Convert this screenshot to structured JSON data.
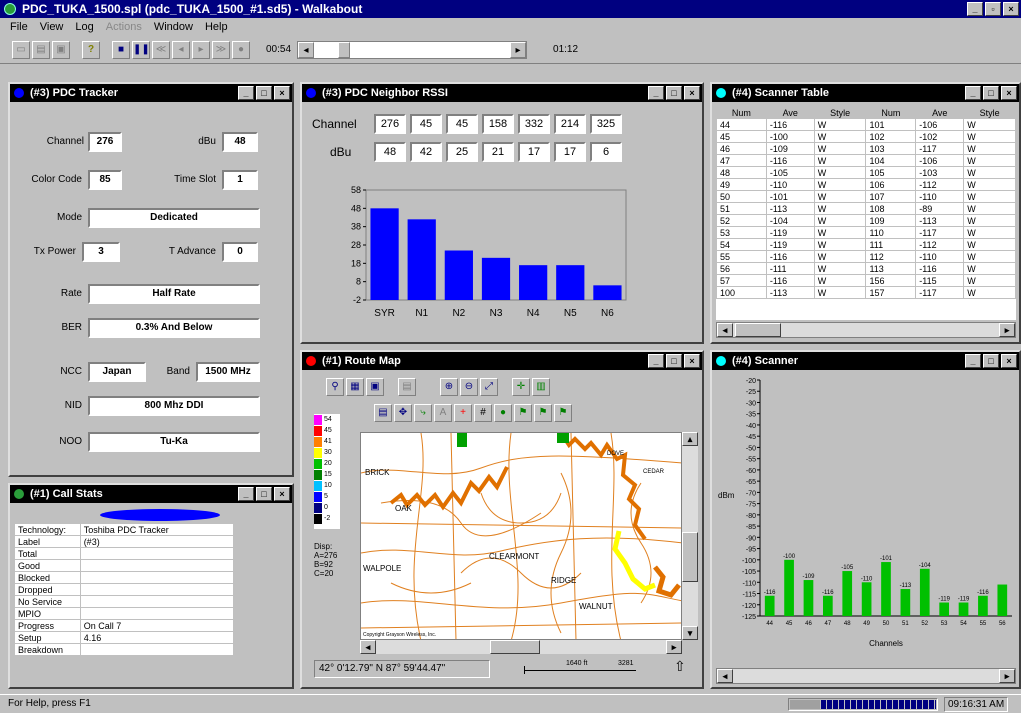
{
  "app": {
    "title": "PDC_TUKA_1500.spl (pdc_TUKA_1500_#1.sd5) - Walkabout"
  },
  "menu": [
    "File",
    "View",
    "Log",
    "Actions",
    "Window",
    "Help"
  ],
  "toolbar": {
    "time_start": "00:54",
    "time_end": "01:12"
  },
  "tracker": {
    "title": "(#3) PDC Tracker",
    "channel_label": "Channel",
    "channel": "276",
    "dbu_label": "dBu",
    "dbu": "48",
    "color_code_label": "Color Code",
    "color_code": "85",
    "time_slot_label": "Time Slot",
    "time_slot": "1",
    "mode_label": "Mode",
    "mode": "Dedicated",
    "tx_power_label": "Tx Power",
    "tx_power": "3",
    "t_advance_label": "T Advance",
    "t_advance": "0",
    "rate_label": "Rate",
    "rate": "Half Rate",
    "ber_label": "BER",
    "ber": "0.3% And Below",
    "ncc_label": "NCC",
    "ncc": "Japan",
    "band_label": "Band",
    "band": "1500 MHz",
    "nid_label": "NID",
    "nid": "800 Mhz DDI",
    "noo_label": "NOO",
    "noo": "Tu-Ka"
  },
  "rssi": {
    "title": "(#3) PDC Neighbor RSSI",
    "channel_label": "Channel",
    "dbu_label": "dBu",
    "channels": [
      "276",
      "45",
      "45",
      "158",
      "332",
      "214",
      "325"
    ],
    "dbus": [
      "48",
      "42",
      "25",
      "21",
      "17",
      "17",
      "6"
    ]
  },
  "chart_data": [
    {
      "type": "bar",
      "categories": [
        "SYR",
        "N1",
        "N2",
        "N3",
        "N4",
        "N5",
        "N6"
      ],
      "values": [
        48,
        42,
        25,
        21,
        17,
        17,
        6
      ],
      "ylim": [
        -2,
        58
      ],
      "yticks": [
        "58",
        "48",
        "38",
        "28",
        "18",
        "8",
        "-2"
      ],
      "color": "#0000ff"
    },
    {
      "type": "bar",
      "title": "",
      "ylabel": "dBm",
      "xlabel": "Channels",
      "categories": [
        "44",
        "45",
        "46",
        "47",
        "48",
        "49",
        "50",
        "51",
        "52",
        "53",
        "54",
        "55",
        "56"
      ],
      "values": [
        -116,
        -100,
        -109,
        -116,
        -105,
        -110,
        -101,
        -113,
        -104,
        -119,
        -119,
        -116,
        -111
      ],
      "value_labels": [
        "-116",
        "-100",
        "-109",
        "-116",
        "-105",
        "-110",
        "-101",
        "-113",
        "-104",
        "-119",
        "-119",
        "-116",
        ""
      ],
      "ylim": [
        -125,
        -20
      ],
      "yticks": [
        "-20",
        "-25",
        "-30",
        "-35",
        "-40",
        "-45",
        "-50",
        "-55",
        "-60",
        "-65",
        "-70",
        "-75",
        "-80",
        "-85",
        "-90",
        "-95",
        "-100",
        "-105",
        "-110",
        "-115",
        "-120",
        "-125"
      ],
      "color": "#00c000"
    }
  ],
  "scanner_table": {
    "title": "(#4) Scanner Table",
    "headers": [
      "Num",
      "Ave",
      "Style",
      "Num",
      "Ave",
      "Style"
    ],
    "rows": [
      [
        "44",
        "-116",
        "W",
        "101",
        "-106",
        "W"
      ],
      [
        "45",
        "-100",
        "W",
        "102",
        "-102",
        "W"
      ],
      [
        "46",
        "-109",
        "W",
        "103",
        "-117",
        "W"
      ],
      [
        "47",
        "-116",
        "W",
        "104",
        "-106",
        "W"
      ],
      [
        "48",
        "-105",
        "W",
        "105",
        "-103",
        "W"
      ],
      [
        "49",
        "-110",
        "W",
        "106",
        "-112",
        "W"
      ],
      [
        "50",
        "-101",
        "W",
        "107",
        "-110",
        "W"
      ],
      [
        "51",
        "-113",
        "W",
        "108",
        "-89",
        "W"
      ],
      [
        "52",
        "-104",
        "W",
        "109",
        "-113",
        "W"
      ],
      [
        "53",
        "-119",
        "W",
        "110",
        "-117",
        "W"
      ],
      [
        "54",
        "-119",
        "W",
        "111",
        "-112",
        "W"
      ],
      [
        "55",
        "-116",
        "W",
        "112",
        "-110",
        "W"
      ],
      [
        "56",
        "-111",
        "W",
        "113",
        "-116",
        "W"
      ],
      [
        "57",
        "-116",
        "W",
        "156",
        "-115",
        "W"
      ],
      [
        "100",
        "-113",
        "W",
        "157",
        "-117",
        "W"
      ]
    ]
  },
  "callstats": {
    "title": "(#1) Call Stats",
    "rows": [
      [
        "Technology:",
        "Toshiba PDC Tracker"
      ],
      [
        "Label",
        "(#3)"
      ],
      [
        "Total",
        ""
      ],
      [
        "Good",
        ""
      ],
      [
        "Blocked",
        ""
      ],
      [
        "Dropped",
        ""
      ],
      [
        "No Service",
        ""
      ],
      [
        "MPIO",
        ""
      ],
      [
        "Progress",
        "On Call  7"
      ],
      [
        "Setup",
        "4.16"
      ],
      [
        "Breakdown",
        ""
      ]
    ]
  },
  "map": {
    "title": "(#1) Route Map",
    "legend": [
      "54",
      "45",
      "41",
      "30",
      "20",
      "15",
      "10",
      "5",
      "0",
      "-2"
    ],
    "legend_colors": [
      "#ff00ff",
      "#ff0000",
      "#ff8000",
      "#ffff00",
      "#00c000",
      "#008000",
      "#00c0ff",
      "#0000ff",
      "#000080",
      "#000000"
    ],
    "info_lines": [
      "Disp:",
      "A=276",
      "B=92",
      "C=20"
    ],
    "labels": [
      "BRICK",
      "OAK",
      "WALPOLE",
      "CLEARMONT",
      "RIDGE",
      "WALNUT",
      "DOVE",
      "CEDAR"
    ],
    "copyright": "Copyright Grayson Wireless, Inc.",
    "coords": "42° 0'12.79\" N 87° 59'44.47\"",
    "scale_a": "1640 ft",
    "scale_b": "3281"
  },
  "scanner": {
    "title": "(#4) Scanner"
  },
  "status": {
    "help": "For Help, press F1",
    "time": "09:16:31 AM"
  }
}
